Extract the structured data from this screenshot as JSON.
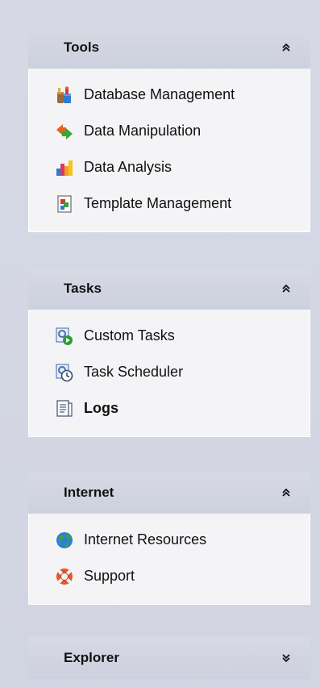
{
  "groups": {
    "tools": {
      "title": "Tools",
      "state": "expanded",
      "items": [
        {
          "label": "Database Management",
          "icon": "database-management-icon"
        },
        {
          "label": "Data Manipulation",
          "icon": "data-manipulation-icon"
        },
        {
          "label": "Data Analysis",
          "icon": "data-analysis-icon"
        },
        {
          "label": "Template Management",
          "icon": "template-management-icon"
        }
      ]
    },
    "tasks": {
      "title": "Tasks",
      "state": "expanded",
      "items": [
        {
          "label": "Custom Tasks",
          "icon": "custom-tasks-icon"
        },
        {
          "label": "Task Scheduler",
          "icon": "task-scheduler-icon"
        },
        {
          "label": "Logs",
          "icon": "logs-icon"
        }
      ]
    },
    "internet": {
      "title": "Internet",
      "state": "expanded",
      "items": [
        {
          "label": "Internet Resources",
          "icon": "globe-icon"
        },
        {
          "label": "Support",
          "icon": "lifebuoy-icon"
        }
      ]
    },
    "explorer": {
      "title": "Explorer",
      "state": "collapsed"
    }
  },
  "colors": {
    "panel_background": "#d3d6e2",
    "group_body": "#f4f4f7",
    "text": "#111111"
  }
}
